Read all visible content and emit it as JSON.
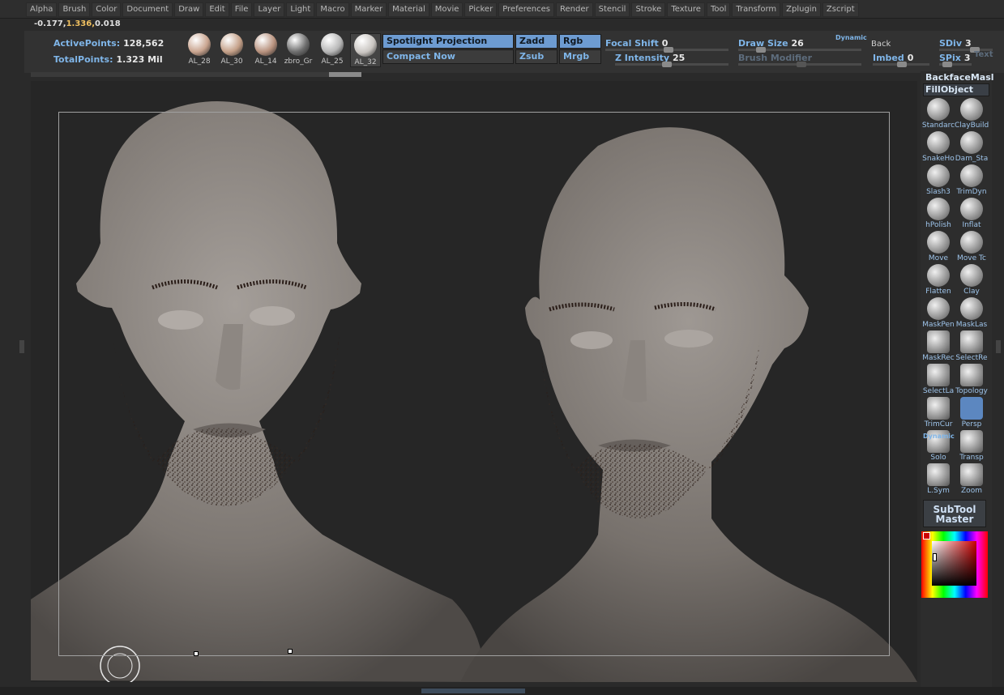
{
  "menu": [
    "Alpha",
    "Brush",
    "Color",
    "Document",
    "Draw",
    "Edit",
    "File",
    "Layer",
    "Light",
    "Macro",
    "Marker",
    "Material",
    "Movie",
    "Picker",
    "Preferences",
    "Render",
    "Stencil",
    "Stroke",
    "Texture",
    "Tool",
    "Transform",
    "Zplugin",
    "Zscript"
  ],
  "coords": {
    "x": "-0.177,",
    "y": "1.336,",
    "z": "0.018"
  },
  "points": {
    "active_label": "ActivePoints:",
    "active_value": "128,562",
    "total_label": "TotalPoints:",
    "total_value": "1.323 Mil"
  },
  "materials": [
    {
      "label": "AL_28",
      "color": "#c9a48f"
    },
    {
      "label": "AL_30",
      "color": "#c4a088"
    },
    {
      "label": "AL_14",
      "color": "#b8927e"
    },
    {
      "label": "zbro_Gr",
      "color": "#6e6e6e"
    },
    {
      "label": "AL_25",
      "color": "#b7b7b7"
    },
    {
      "label": "AL_32",
      "color": "#c8c4c0"
    }
  ],
  "projection": {
    "spotlight": "Spotlight Projection",
    "compact": "Compact Now"
  },
  "modes": {
    "zadd": "Zadd",
    "zsub": "Zsub",
    "rgb": "Rgb",
    "mrgb": "Mrgb"
  },
  "sliders": {
    "focal_label": "Focal Shift",
    "focal_value": "0",
    "zint_label": "Z Intensity",
    "zint_value": "25",
    "draw_label": "Draw Size",
    "draw_value": "26",
    "brushmod_label": "Brush Modifier",
    "dynamic": "Dynamic",
    "back_label": "Back",
    "imbed_label": "Imbed",
    "imbed_value": "0",
    "sdiv_label": "SDiv",
    "sdiv_value": "3",
    "spix_label": "SPix",
    "spix_value": "3",
    "text_label": "Text"
  },
  "right": {
    "backface": "BackfaceMasl",
    "fillobject": "FillObject",
    "brushes": [
      "Standarc",
      "ClayBuild",
      "SnakeHo",
      "Dam_Sta",
      "Slash3",
      "TrimDyn",
      "hPolish",
      "Inflat",
      "Move",
      "Move Tc",
      "Flatten",
      "Clay",
      "MaskPen",
      "MaskLas",
      "MaskRec",
      "SelectRe",
      "SelectLa",
      "Topology",
      "TrimCur",
      "Persp",
      "Solo",
      "Transp",
      "L.Sym",
      "Zoom"
    ],
    "dynamic_label": "Dynamic",
    "subtool_1": "SubTool",
    "subtool_2": "Master"
  }
}
